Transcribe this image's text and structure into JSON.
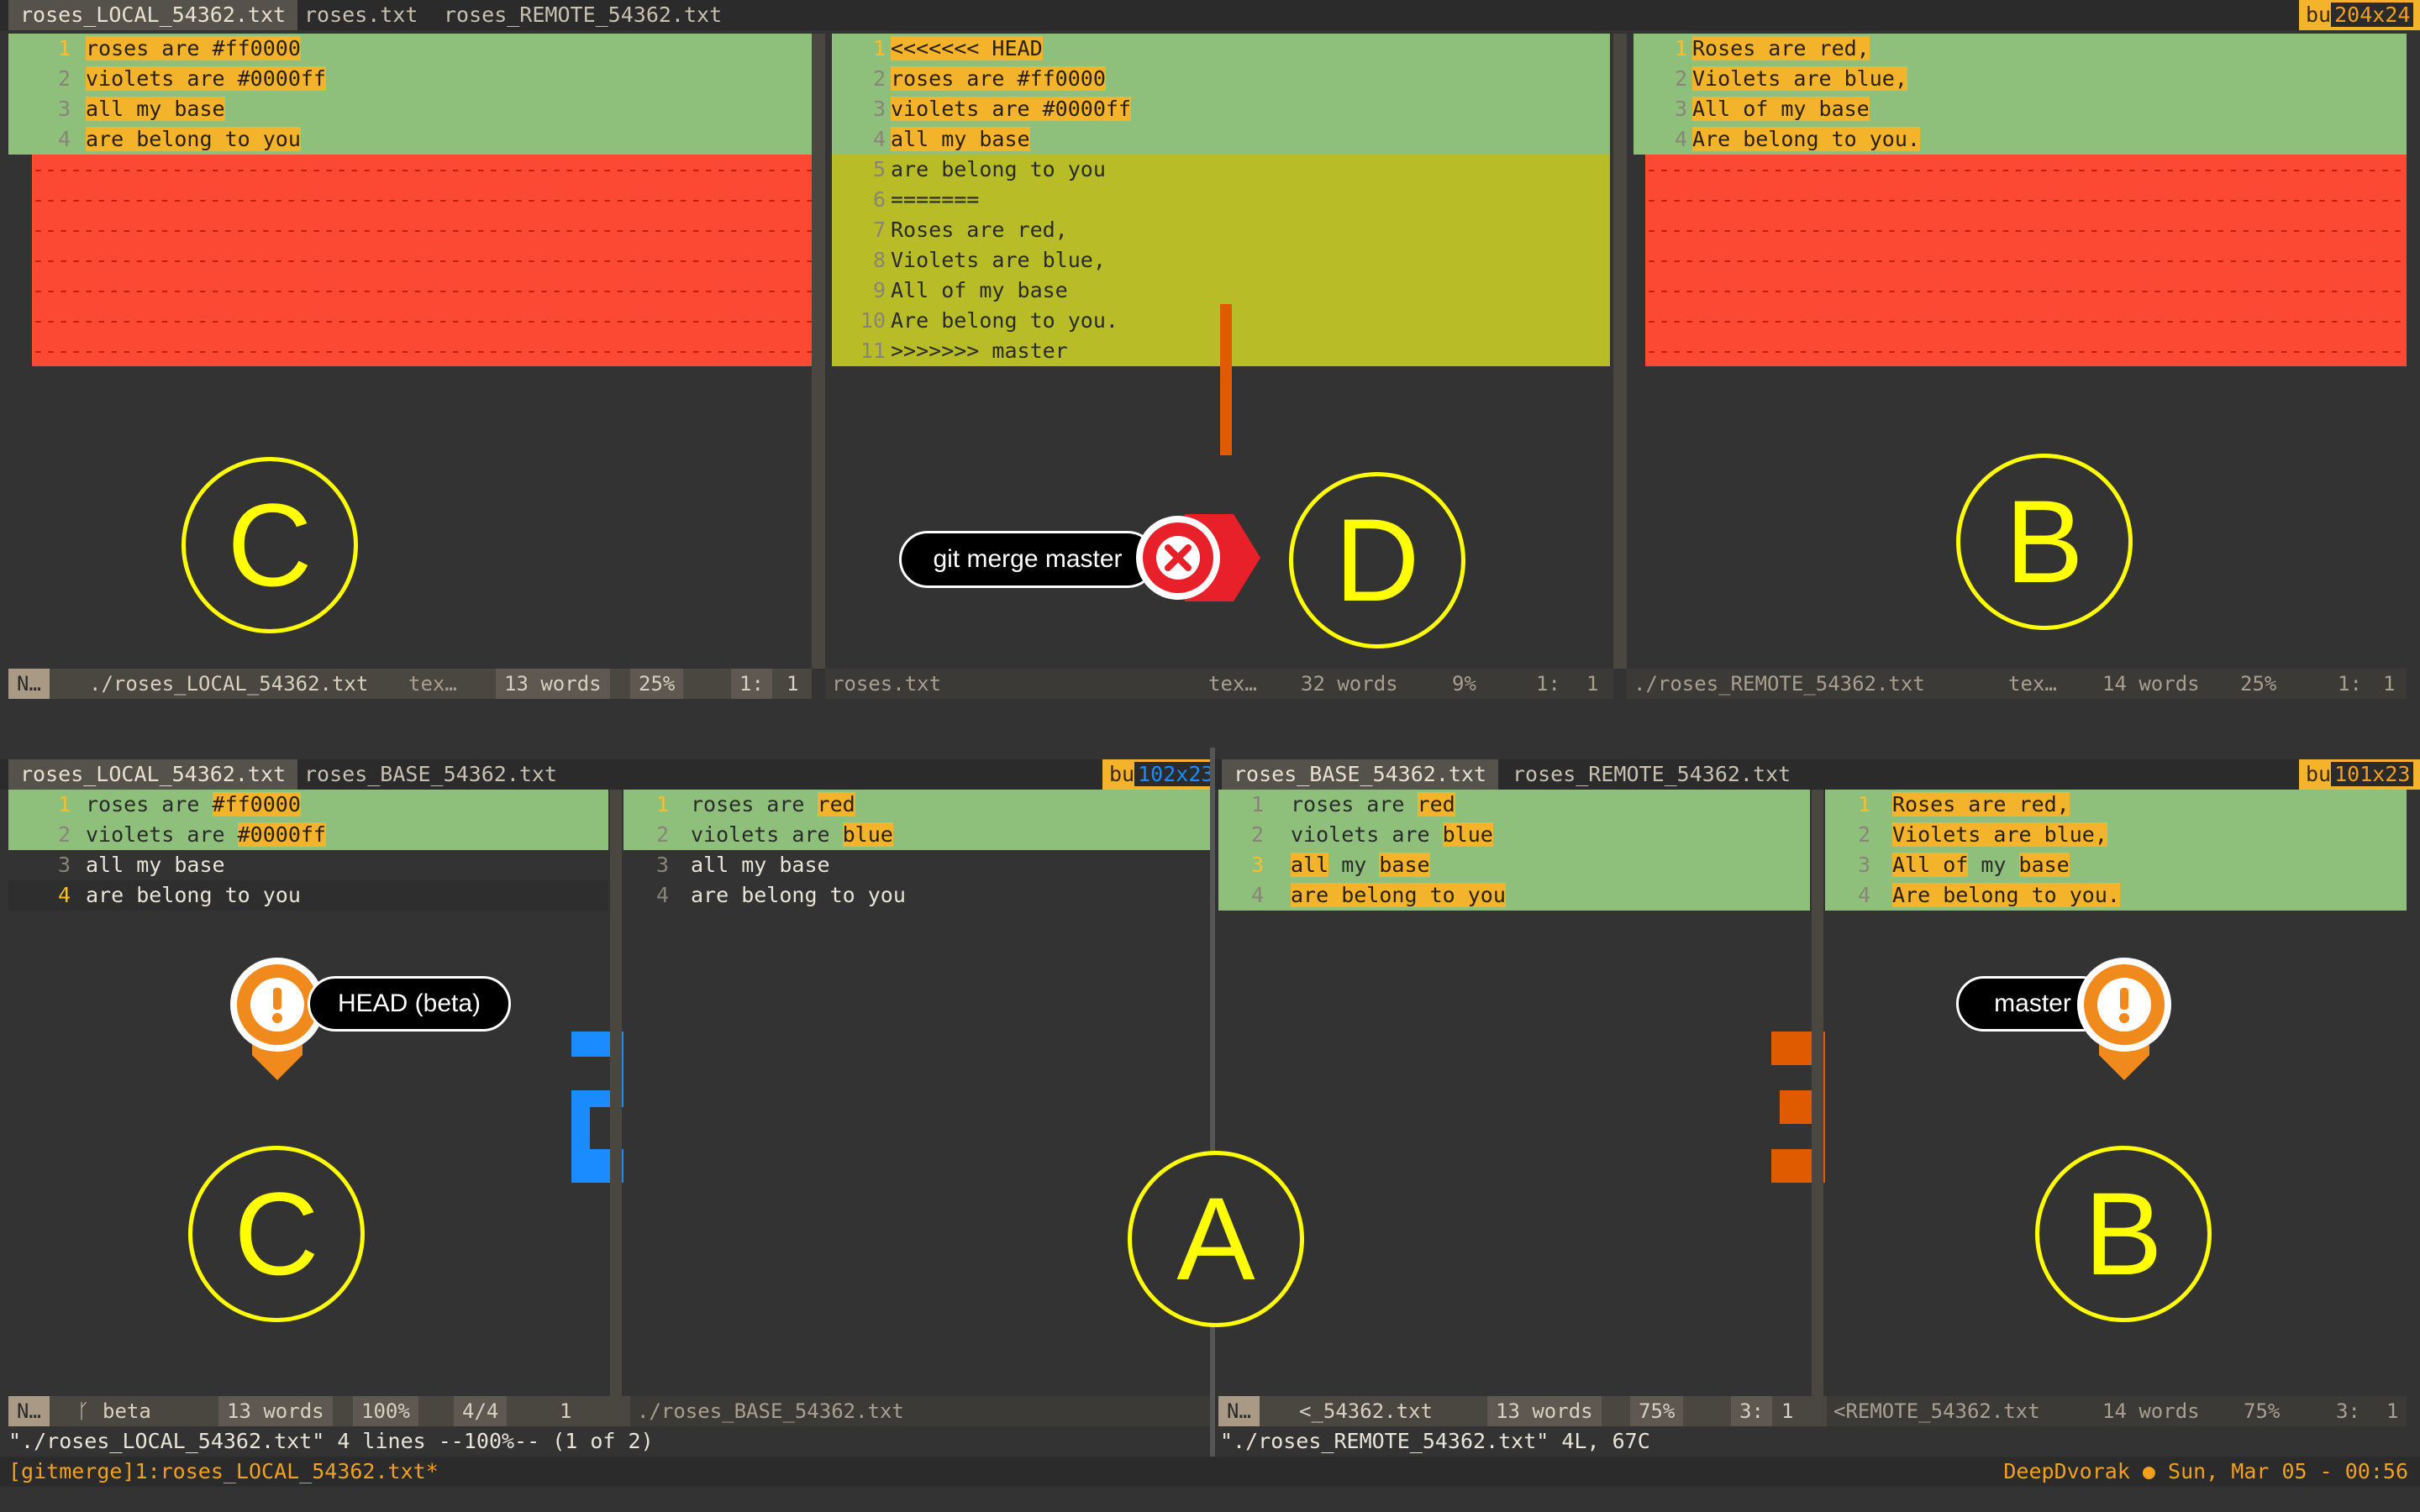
{
  "top": {
    "tabs": [
      "roses_LOCAL_54362.txt",
      "roses.txt",
      "roses_REMOTE_54362.txt"
    ],
    "buf_prefix": "bu",
    "buf_size": "204x24",
    "local_lines": [
      "roses are #ff0000",
      "violets are #0000ff",
      "all my base",
      "are belong to you"
    ],
    "merged_lines": [
      "<<<<<<< HEAD",
      "roses are #ff0000",
      "violets are #0000ff",
      "all my base",
      "are belong to you",
      "=======",
      "Roses are red,",
      "Violets are blue,",
      "All of my base",
      "Are belong to you.",
      ">>>>>>> master"
    ],
    "remote_lines": [
      "Roses are red,",
      "Violets are blue,",
      "All of my base",
      "Are belong to you."
    ],
    "status_left": {
      "mode": "N…",
      "file": "./roses_LOCAL_54362.txt",
      "type": "tex…",
      "words": "13 words",
      "pct": "25%",
      "pos": "1:",
      "col": "1"
    },
    "status_mid": {
      "file": "roses.txt",
      "type": "tex…",
      "words": "32 words",
      "pct": "9%",
      "pos": "1:",
      "col": "1"
    },
    "status_right": {
      "file": "./roses_REMOTE_54362.txt",
      "type": "tex…",
      "words": "14 words",
      "pct": "25%",
      "pos": "1:",
      "col": "1"
    }
  },
  "bottom_left": {
    "tabs": [
      "roses_LOCAL_54362.txt",
      "roses_BASE_54362.txt"
    ],
    "buf_prefix": "bu",
    "buf_size": "102x23",
    "left_lines": [
      "roses are #ff0000",
      "violets are #0000ff",
      "all my base",
      "are belong to you"
    ],
    "base_lines": [
      "roses are red",
      "violets are blue",
      "all my base",
      "are belong to you"
    ],
    "status": {
      "mode": "N…",
      "branch": "beta",
      "words": "13 words",
      "pct": "100%",
      "pos": "4/4",
      "col": "1",
      "file2": "./roses_BASE_54362.txt"
    },
    "cmdline": "\"./roses_LOCAL_54362.txt\" 4 lines --100%-- (1 of 2)"
  },
  "bottom_right": {
    "tabs": [
      "roses_BASE_54362.txt",
      "roses_REMOTE_54362.txt"
    ],
    "buf_prefix": "bu",
    "buf_size": "101x23",
    "left_lines": [
      "roses are red",
      "violets are blue",
      "all my base",
      "are belong to you"
    ],
    "right_lines": [
      "Roses are red,",
      "Violets are blue,",
      "All of my base",
      "Are belong to you."
    ],
    "status": {
      "mode": "N…",
      "file": "<_54362.txt",
      "words": "13 words",
      "pct": "75%",
      "pos": "3:",
      "col": "1",
      "file2": "<REMOTE_54362.txt",
      "words2": "14 words",
      "pct2": "75%",
      "pos2": "3:",
      "col2": "1"
    },
    "cmdline": "\"./roses_REMOTE_54362.txt\" 4L, 67C"
  },
  "tmux": {
    "left": "[gitmerge]1:roses_LOCAL_54362.txt*",
    "right": "DeepDvorak ● Sun, Mar 05 - 00:56"
  },
  "annotations": {
    "C": "C",
    "D": "D",
    "B": "B",
    "A": "A",
    "git_merge": "git merge master",
    "head_beta": "HEAD (beta)",
    "master": "master"
  },
  "colors": {
    "added": "#8ec07c",
    "deleted": "#fb4934",
    "changed": "#b8bc26",
    "highlight": "#f3b32a",
    "annotation": "#ffff00",
    "orange": "#f08a1c",
    "blue": "#1a8cff"
  }
}
